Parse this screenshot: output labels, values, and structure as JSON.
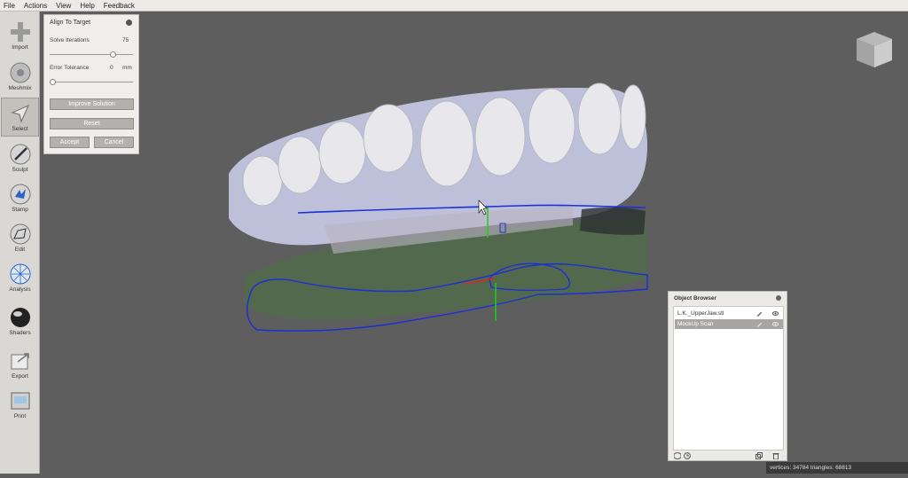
{
  "menu": [
    "File",
    "Actions",
    "View",
    "Help",
    "Feedback"
  ],
  "tools": [
    {
      "label": "Import",
      "icon": "import-icon"
    },
    {
      "label": "Meshmix",
      "icon": "meshmix-icon"
    },
    {
      "label": "Select",
      "icon": "select-icon"
    },
    {
      "label": "Sculpt",
      "icon": "sculpt-icon"
    },
    {
      "label": "Stamp",
      "icon": "stamp-icon"
    },
    {
      "label": "Edit",
      "icon": "edit-icon"
    },
    {
      "label": "Analysis",
      "icon": "analysis-icon"
    },
    {
      "label": "Shaders",
      "icon": "shaders-icon"
    },
    {
      "label": "Export",
      "icon": "export-icon"
    },
    {
      "label": "Print",
      "icon": "print-icon"
    }
  ],
  "align_panel": {
    "title": "Align To Target",
    "solve_iterations_label": "Solve Iterations",
    "solve_iterations_value": "75",
    "solve_iterations_fraction": 0.75,
    "error_tolerance_label": "Error Tolerance",
    "error_tolerance_value": "0",
    "error_tolerance_unit": "mm",
    "error_tolerance_fraction": 0.0,
    "improve_label": "Improve Solution",
    "reset_label": "Reset",
    "accept_label": "Accept",
    "cancel_label": "Cancel"
  },
  "object_browser": {
    "title": "Object Browser",
    "items": [
      {
        "name": "L.K._UpperJaw.stl",
        "selected": false
      },
      {
        "name": "MockUp Scan",
        "selected": true
      }
    ]
  },
  "status_bar": "vertices: 34784 triangles: 68813",
  "colors": {
    "accent_blue": "#1a2fd6",
    "axis_green": "#19d11c",
    "axis_red": "#e02424"
  }
}
